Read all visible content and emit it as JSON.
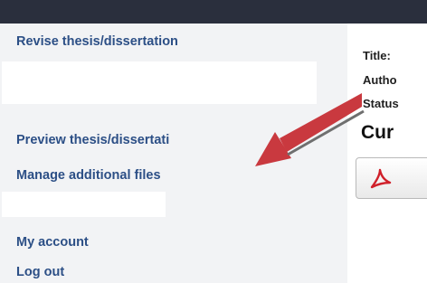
{
  "sidebar": {
    "revise_label": "Revise thesis/dissertation",
    "preview_label": "Preview thesis/dissertati",
    "manage_files_label": "Manage additional files",
    "account_label": "My account",
    "logout_label": "Log out"
  },
  "main": {
    "title_label": "Title:",
    "author_label": "Autho",
    "status_label": "Status",
    "section_heading": "Cur"
  },
  "icons": {
    "pdf": "pdf-icon",
    "pointer": "red-arrow-icon"
  },
  "colors": {
    "topbar": "#2a2f3d",
    "sidebar_bg": "#f2f3f5",
    "link": "#2c4f86",
    "arrow": "#c9393f",
    "pdf": "#d0202a"
  }
}
